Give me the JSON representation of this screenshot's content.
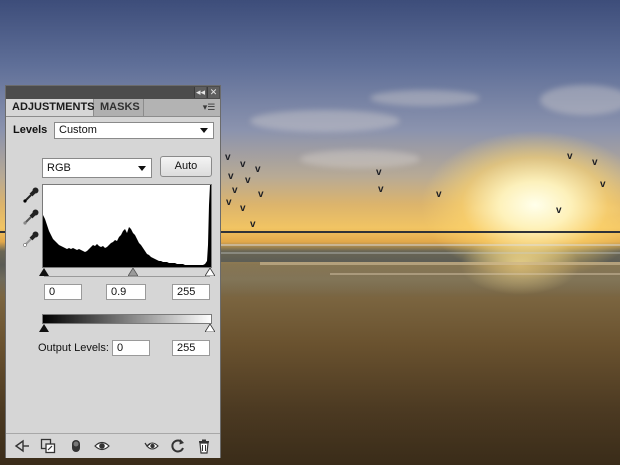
{
  "panel": {
    "tabs": [
      {
        "label": "ADJUSTMENTS",
        "active": true
      },
      {
        "label": "MASKS",
        "active": false
      }
    ],
    "window_controls": [
      "collapse-icon",
      "close-icon"
    ],
    "menu_icon": "panel-menu-icon"
  },
  "levels": {
    "title": "Levels",
    "preset": "Custom",
    "channel": "RGB",
    "auto_label": "Auto",
    "eyedroppers": [
      "black-point-eyedropper-icon",
      "gray-point-eyedropper-icon",
      "white-point-eyedropper-icon"
    ],
    "input": {
      "black": "0",
      "gamma": "0.9",
      "white": "255"
    },
    "output_label": "Output Levels:",
    "output": {
      "black": "0",
      "white": "255"
    }
  },
  "bottom_icons": [
    "return-to-list-icon",
    "expanded-view-icon",
    "clip-to-layer-icon",
    "visibility-eye-icon",
    "previous-state-icon",
    "reset-icon",
    "trash-icon"
  ],
  "colors": {
    "panel_bg": "#d6d6d6",
    "topbar": "#4c4c4c",
    "tab_bar": "#b3b3b3"
  }
}
